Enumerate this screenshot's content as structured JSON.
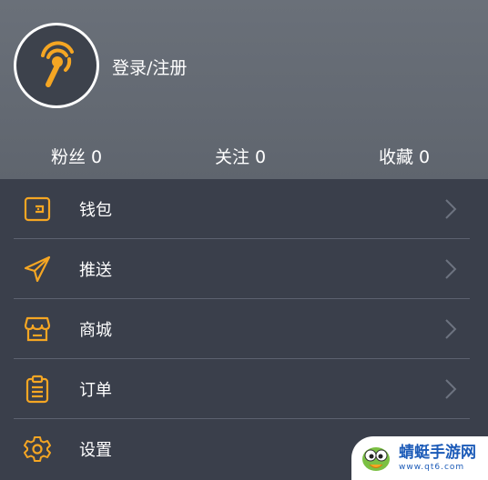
{
  "user": {
    "login_label": "登录/注册"
  },
  "stats": {
    "fans": "粉丝 0",
    "follow": "关注 0",
    "favorites": "收藏 0"
  },
  "menu": [
    {
      "label": "钱包",
      "icon": "wallet-icon"
    },
    {
      "label": "推送",
      "icon": "paper-plane-icon"
    },
    {
      "label": "商城",
      "icon": "store-icon"
    },
    {
      "label": "订单",
      "icon": "clipboard-icon"
    },
    {
      "label": "设置",
      "icon": "gear-icon"
    }
  ],
  "watermark": {
    "title": "蜻蜓手游网",
    "url": "www.qt6.com"
  },
  "colors": {
    "accent": "#f5a623",
    "header_bg": "#646a73",
    "menu_bg": "#3a3f4b"
  }
}
